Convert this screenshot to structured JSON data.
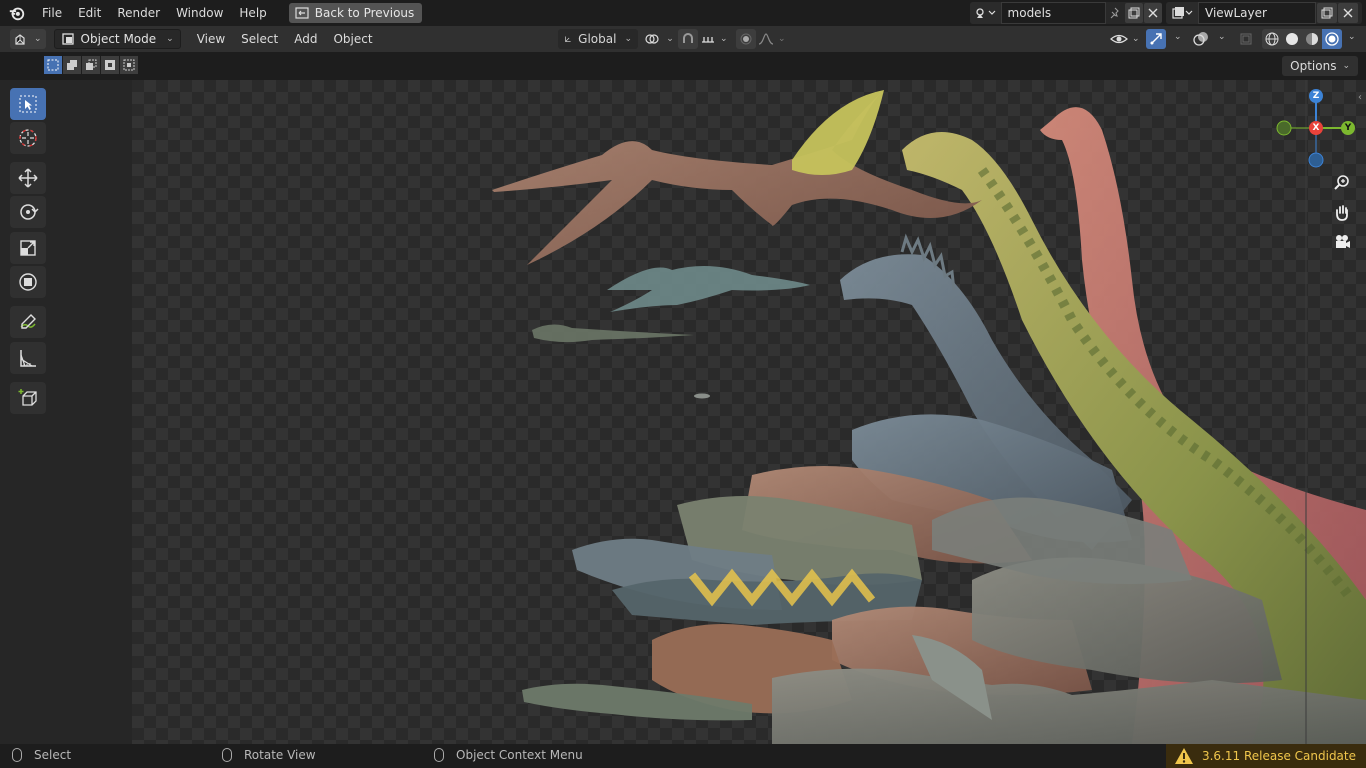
{
  "menu": {
    "items": [
      "File",
      "Edit",
      "Render",
      "Window",
      "Help"
    ],
    "back_button": "Back to Previous"
  },
  "scene": {
    "name": "models"
  },
  "view_layer": {
    "name": "ViewLayer"
  },
  "header": {
    "mode": "Object Mode",
    "menus": [
      "View",
      "Select",
      "Add",
      "Object"
    ],
    "orientation": "Global"
  },
  "subheader": {
    "options_label": "Options"
  },
  "gizmo": {
    "x": "X",
    "y": "Y",
    "z": "Z"
  },
  "status": {
    "select": "Select",
    "rotate": "Rotate View",
    "context": "Object Context Menu",
    "version": "3.6.11 Release Candidate"
  },
  "colors": {
    "accent": "#4772b3",
    "axis_x": "#e8423a",
    "axis_y": "#7cb82f",
    "axis_z": "#3c83d6",
    "warning": "#f0c64c"
  },
  "icons": [
    "blender-logo-icon",
    "back-icon",
    "scene-icon",
    "pin-icon",
    "duplicate-icon",
    "close-icon",
    "view-layer-icon",
    "editor-type-icon",
    "object-mode-icon",
    "transform-orientation-icon",
    "pivot-icon",
    "snap-icon",
    "proportional-icon",
    "visibility-icon",
    "gizmo-icon",
    "overlay-icon",
    "xray-icon",
    "wireframe-icon",
    "solid-icon",
    "material-icon",
    "rendered-icon",
    "select-box-icon",
    "cursor-icon",
    "move-icon",
    "rotate-icon",
    "scale-icon",
    "transform-icon",
    "annotate-icon",
    "measure-icon",
    "add-cube-icon",
    "zoom-icon",
    "hand-icon",
    "camera-icon",
    "warning-icon"
  ]
}
